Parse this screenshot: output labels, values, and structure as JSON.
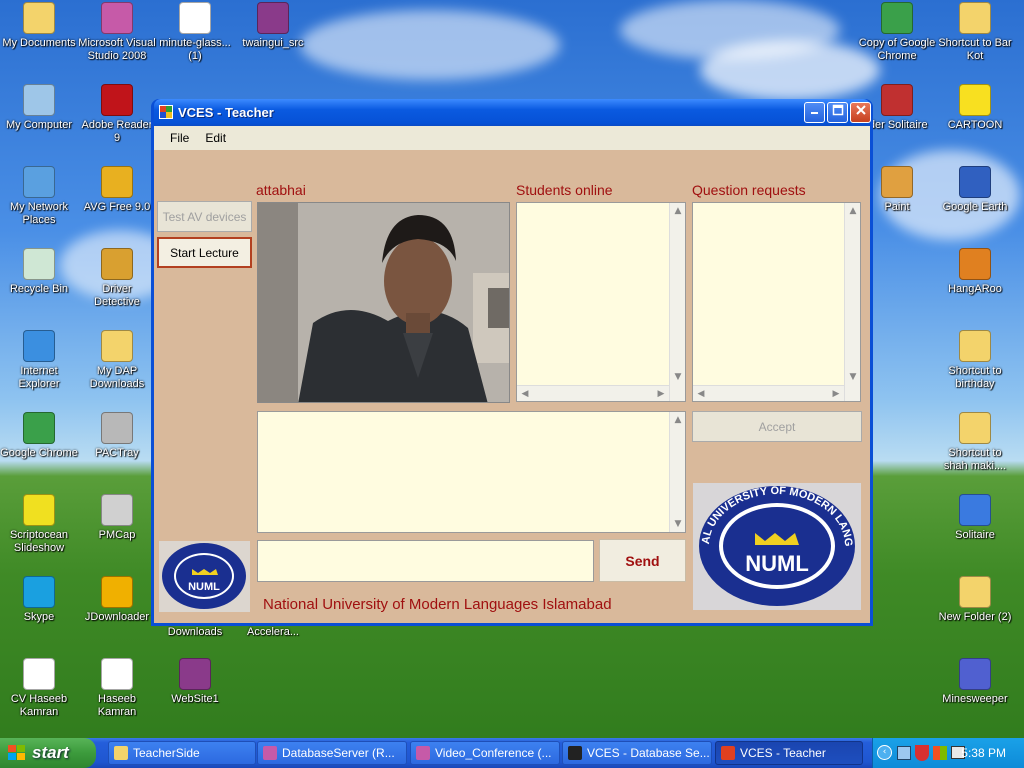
{
  "desktop": {
    "icons_left": [
      {
        "label": "My Documents",
        "icon": "folder-documents-icon",
        "color": "#f3d36b"
      },
      {
        "label": "Microsoft Visual Studio 2008",
        "icon": "visual-studio-icon",
        "color": "#c65aa8"
      },
      {
        "label": "minute-glass... (1)",
        "icon": "document-icon",
        "color": "#ffffff"
      },
      {
        "label": "twaingui_src",
        "icon": "winrar-archive-icon",
        "color": "#8a3a8a"
      },
      {
        "label": "My Computer",
        "icon": "computer-icon",
        "color": "#9ec6e8"
      },
      {
        "label": "Adobe Reader 9",
        "icon": "adobe-reader-icon",
        "color": "#c0141a"
      },
      {
        "label": "My Network Places",
        "icon": "network-places-icon",
        "color": "#5aa0e0"
      },
      {
        "label": "AVG Free 9.0",
        "icon": "avg-icon",
        "color": "#e8b020"
      },
      {
        "label": "Recycle Bin",
        "icon": "recycle-bin-icon",
        "color": "#cfe7d4"
      },
      {
        "label": "Driver Detective",
        "icon": "driver-detective-icon",
        "color": "#d9a030"
      },
      {
        "label": "Internet Explorer",
        "icon": "internet-explorer-icon",
        "color": "#3b8fe0"
      },
      {
        "label": "My DAP Downloads",
        "icon": "folder-download-icon",
        "color": "#f3d36b"
      },
      {
        "label": "Google Chrome",
        "icon": "chrome-icon",
        "color": "#3aa04a"
      },
      {
        "label": "PACTray",
        "icon": "webcam-icon",
        "color": "#b8b8b8"
      },
      {
        "label": "Scriptocean Slideshow",
        "icon": "dx-icon",
        "color": "#f0e020"
      },
      {
        "label": "PMCap",
        "icon": "pmcap-icon",
        "color": "#d0d0d0"
      },
      {
        "label": "Skype",
        "icon": "skype-icon",
        "color": "#1aa0e0"
      },
      {
        "label": "JDownloader",
        "icon": "jdownloader-icon",
        "color": "#f0b000"
      },
      {
        "label": "CV Haseeb Kamran",
        "icon": "word-doc-icon",
        "color": "#ffffff"
      },
      {
        "label": "Haseeb Kamran",
        "icon": "word-doc-icon",
        "color": "#ffffff"
      },
      {
        "label": "WebSite1",
        "icon": "winrar-archive-icon",
        "color": "#8a3a8a"
      }
    ],
    "icons_right": [
      {
        "label": "Copy of Google Chrome",
        "icon": "chrome-icon",
        "color": "#3aa04a"
      },
      {
        "label": "Shortcut to Bar Kot",
        "icon": "folder-icon",
        "color": "#f3d36b"
      },
      {
        "label": "ider Solitaire",
        "icon": "spider-solitaire-icon",
        "color": "#c03030"
      },
      {
        "label": "CARTOON",
        "icon": "star-icon",
        "color": "#f8e020"
      },
      {
        "label": "Paint",
        "icon": "paint-icon",
        "color": "#e0a040"
      },
      {
        "label": "Google Earth",
        "icon": "google-earth-icon",
        "color": "#3060c0"
      },
      {
        "label": "HangARoo",
        "icon": "hangaroo-icon",
        "color": "#e08020"
      },
      {
        "label": "Shortcut to birthday",
        "icon": "folder-icon",
        "color": "#f3d36b"
      },
      {
        "label": "Shortcut to shah maki....",
        "icon": "folder-icon",
        "color": "#f3d36b"
      },
      {
        "label": "Solitaire",
        "icon": "solitaire-icon",
        "color": "#3a7ae0"
      },
      {
        "label": "New Folder (2)",
        "icon": "folder-icon",
        "color": "#f3d36b"
      },
      {
        "label": "Minesweeper",
        "icon": "minesweeper-icon",
        "color": "#5060d0"
      }
    ],
    "partial_labels": [
      "Downloads",
      "Accelera..."
    ]
  },
  "window": {
    "title": "VCES - Teacher",
    "menu": [
      "File",
      "Edit"
    ],
    "username_label": "attabhai",
    "students_label": "Students online",
    "questions_label": "Question requests",
    "test_av_label": "Test AV devices",
    "start_lecture_label": "Start Lecture",
    "accept_label": "Accept",
    "send_label": "Send",
    "chat_input_value": "",
    "footer_text": "National University of Modern Languages Islamabad",
    "logo_text": "NATIONAL UNIVERSITY OF MODERN LANGUAGES",
    "logo_monogram": "NUML"
  },
  "taskbar": {
    "start_label": "start",
    "tasks": [
      {
        "label": "TeacherSide",
        "icon": "folder-icon"
      },
      {
        "label": "DatabaseServer (R...",
        "icon": "visual-studio-icon"
      },
      {
        "label": "Video_Conference (...",
        "icon": "visual-studio-icon"
      },
      {
        "label": "VCES - Database Se...",
        "icon": "console-icon"
      },
      {
        "label": "VCES - Teacher",
        "icon": "form-app-icon"
      }
    ],
    "clock": "5:38 PM"
  },
  "colors": {
    "form_bg": "#d9b99b",
    "label_red": "#a01010",
    "panel_bg": "#fffce0",
    "logo_blue": "#1a2f90",
    "logo_yellow": "#f0d020"
  }
}
